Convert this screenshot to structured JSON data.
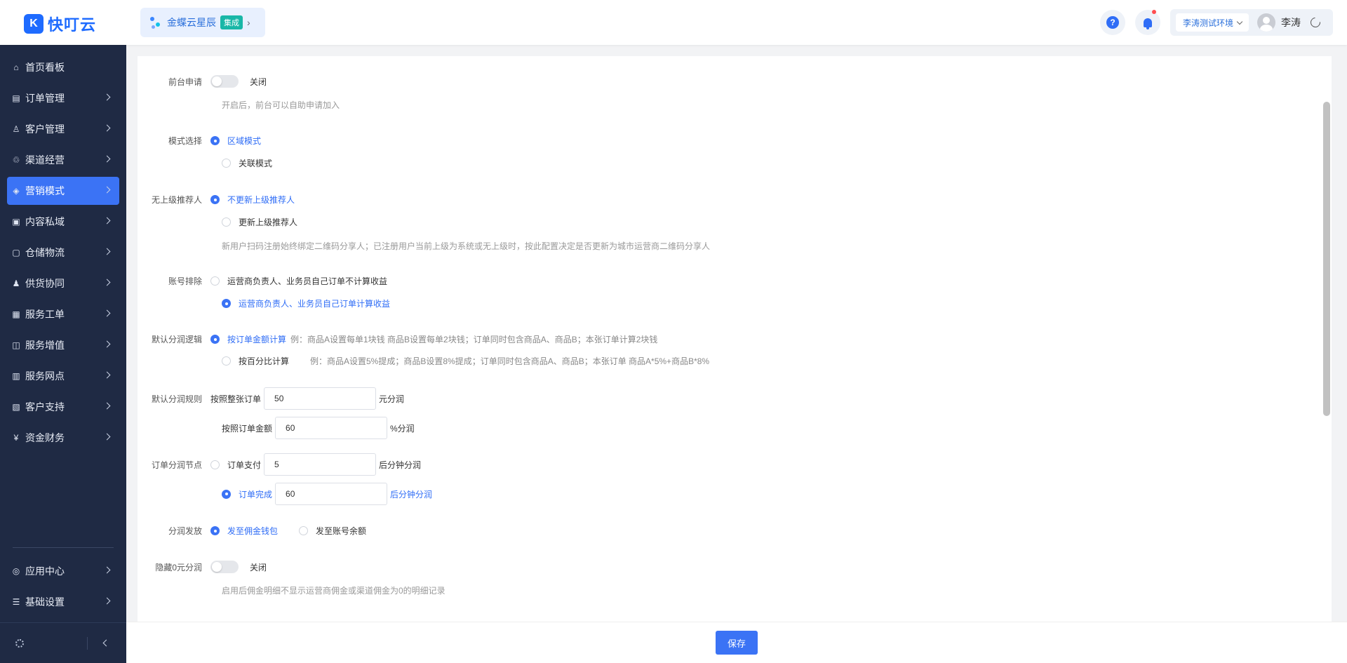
{
  "header": {
    "logo_text": "快叮云",
    "logo_mark": "K",
    "integration_name": "金蝶云星辰",
    "integration_tag": "集成",
    "help_icon_glyph": "?",
    "environment": "李涛测试环境",
    "user_name": "李涛"
  },
  "sidebar": {
    "items": [
      {
        "label": "首页看板",
        "icon": "home-icon",
        "glyph": "⌂"
      },
      {
        "label": "订单管理",
        "icon": "order-icon",
        "glyph": "▤"
      },
      {
        "label": "客户管理",
        "icon": "user-icon",
        "glyph": "♙"
      },
      {
        "label": "渠道经营",
        "icon": "channel-icon",
        "glyph": "♲"
      },
      {
        "label": "营销模式",
        "icon": "tag-icon",
        "glyph": "◈"
      },
      {
        "label": "内容私域",
        "icon": "image-icon",
        "glyph": "▣"
      },
      {
        "label": "仓储物流",
        "icon": "box-icon",
        "glyph": "▢"
      },
      {
        "label": "供货协同",
        "icon": "supply-icon",
        "glyph": "♟"
      },
      {
        "label": "服务工单",
        "icon": "ticket-icon",
        "glyph": "▦"
      },
      {
        "label": "服务增值",
        "icon": "bag-icon",
        "glyph": "◫"
      },
      {
        "label": "服务网点",
        "icon": "store-icon",
        "glyph": "▥"
      },
      {
        "label": "客户支持",
        "icon": "support-icon",
        "glyph": "▧"
      },
      {
        "label": "资金财务",
        "icon": "finance-icon",
        "glyph": "¥"
      }
    ],
    "bottom_items": [
      {
        "label": "应用中心",
        "icon": "cube-icon",
        "glyph": "◎"
      },
      {
        "label": "基础设置",
        "icon": "settings-list-icon",
        "glyph": "☰"
      }
    ],
    "active_index": 4
  },
  "form": {
    "front_apply": {
      "label": "前台申请",
      "switch_text": "关闭",
      "hint": "开启后，前台可以自助申请加入"
    },
    "mode": {
      "label": "模式选择",
      "options": [
        "区域模式",
        "关联模式"
      ],
      "selected": 0
    },
    "no_referrer": {
      "label": "无上级推荐人",
      "options": [
        "不更新上级推荐人",
        "更新上级推荐人"
      ],
      "selected": 0,
      "hint": "新用户扫码注册始终绑定二维码分享人；已注册用户当前上级为系统或无上级时，按此配置决定是否更新为城市运营商二维码分享人"
    },
    "account_exclude": {
      "label": "账号排除",
      "options": [
        "运营商负责人、业务员自己订单不计算收益",
        "运营商负责人、业务员自己订单计算收益"
      ],
      "selected": 1
    },
    "default_logic": {
      "label": "默认分润逻辑",
      "options": [
        "按订单金额计算",
        "按百分比计算"
      ],
      "selected": 0,
      "examples": [
        "例：商品A设置每单1块钱 商品B设置每单2块钱；订单同时包含商品A、商品B；本张订单计算2块钱",
        "例：商品A设置5%提成；商品B设置8%提成；订单同时包含商品A、商品B；本张订单 商品A*5%+商品B*8%"
      ]
    },
    "default_rule": {
      "label": "默认分润规则",
      "rows": [
        {
          "pre": "按照整张订单",
          "value": "50",
          "unit": "元分润"
        },
        {
          "pre": "按照订单金额",
          "value": "60",
          "unit": "%分润"
        }
      ]
    },
    "order_node": {
      "label": "订单分润节点",
      "rows": [
        {
          "pre": "订单支付",
          "value": "5",
          "unit": "后分钟分润"
        },
        {
          "pre": "订单完成",
          "value": "60",
          "unit": "后分钟分润"
        }
      ],
      "selected": 1
    },
    "payout": {
      "label": "分润发放",
      "options": [
        "发至佣金钱包",
        "发至账号余额"
      ],
      "selected": 0
    },
    "hide_zero": {
      "label": "隐藏0元分润",
      "switch_text": "关闭",
      "hint": "启用后佣金明细不显示运营商佣金或渠道佣金为0的明细记录"
    }
  },
  "footer": {
    "save_label": "保存"
  },
  "colors": {
    "primary": "#3b73f5",
    "sidebar_bg": "#1f2a44",
    "alert": "#ff4d4f"
  }
}
